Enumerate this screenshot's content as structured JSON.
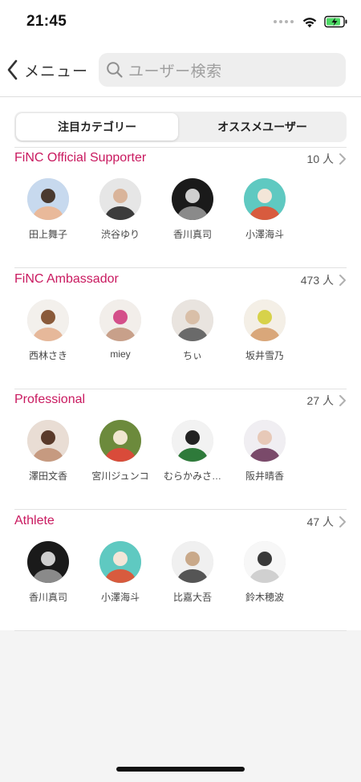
{
  "status_bar": {
    "time": "21:45"
  },
  "nav": {
    "back_label": "メニュー",
    "search_placeholder": "ユーザー検索"
  },
  "tabs": [
    {
      "label": "注目カテゴリー",
      "selected": true
    },
    {
      "label": "オススメユーザー",
      "selected": false
    }
  ],
  "colors": {
    "accent": "#c9195f",
    "background": "#f4f4f4",
    "battery_green": "#4cd964"
  },
  "sections": [
    {
      "title": "FiNC Official Supporter",
      "count": "10 人",
      "users": [
        {
          "name": "田上舞子",
          "avatar_colors": [
            "#c7d9ee",
            "#e9b99a",
            "#4a3a30"
          ]
        },
        {
          "name": "渋谷ゆり",
          "avatar_colors": [
            "#e6e6e6",
            "#3c3c3c",
            "#d9b49a"
          ]
        },
        {
          "name": "香川真司",
          "avatar_colors": [
            "#1a1a1a",
            "#8a8a8a",
            "#cfcfcf"
          ]
        },
        {
          "name": "小澤海斗",
          "avatar_colors": [
            "#5fc9c1",
            "#d85b3e",
            "#f3e6d8"
          ]
        }
      ]
    },
    {
      "title": "FiNC Ambassador",
      "count": "473 人",
      "users": [
        {
          "name": "西林さき",
          "avatar_colors": [
            "#f3f0ec",
            "#e6b89a",
            "#8a5a3a"
          ]
        },
        {
          "name": "miey",
          "avatar_colors": [
            "#f2eeea",
            "#c8a08a",
            "#d44f8a"
          ]
        },
        {
          "name": "ちぃ",
          "avatar_colors": [
            "#e9e4df",
            "#6a6a6a",
            "#d9bfa8"
          ]
        },
        {
          "name": "坂井雪乃",
          "avatar_colors": [
            "#f4efe6",
            "#d9a77a",
            "#d7d24a"
          ]
        }
      ]
    },
    {
      "title": "Professional",
      "count": "27 人",
      "users": [
        {
          "name": "澤田文香",
          "avatar_colors": [
            "#e9ddd4",
            "#c69a80",
            "#5a3a2a"
          ]
        },
        {
          "name": "宮川ジュンコ",
          "avatar_colors": [
            "#6c8a3c",
            "#d94b3a",
            "#f0e6d0"
          ]
        },
        {
          "name": "むらかみさ…",
          "avatar_colors": [
            "#f2f2f2",
            "#2e7a3a",
            "#222222"
          ]
        },
        {
          "name": "阪井晴香",
          "avatar_colors": [
            "#f0eef2",
            "#7a4a6a",
            "#e7c9b8"
          ]
        }
      ]
    },
    {
      "title": "Athlete",
      "count": "47 人",
      "users": [
        {
          "name": "香川真司",
          "avatar_colors": [
            "#1a1a1a",
            "#8a8a8a",
            "#cfcfcf"
          ]
        },
        {
          "name": "小澤海斗",
          "avatar_colors": [
            "#5fc9c1",
            "#d85b3e",
            "#f3e6d8"
          ]
        },
        {
          "name": "比嘉大吾",
          "avatar_colors": [
            "#f0f0f0",
            "#555555",
            "#c9a98a"
          ]
        },
        {
          "name": "鈴木穂波",
          "avatar_colors": [
            "#f7f7f7",
            "#d0d0d0",
            "#3a3a3a"
          ]
        }
      ]
    }
  ]
}
